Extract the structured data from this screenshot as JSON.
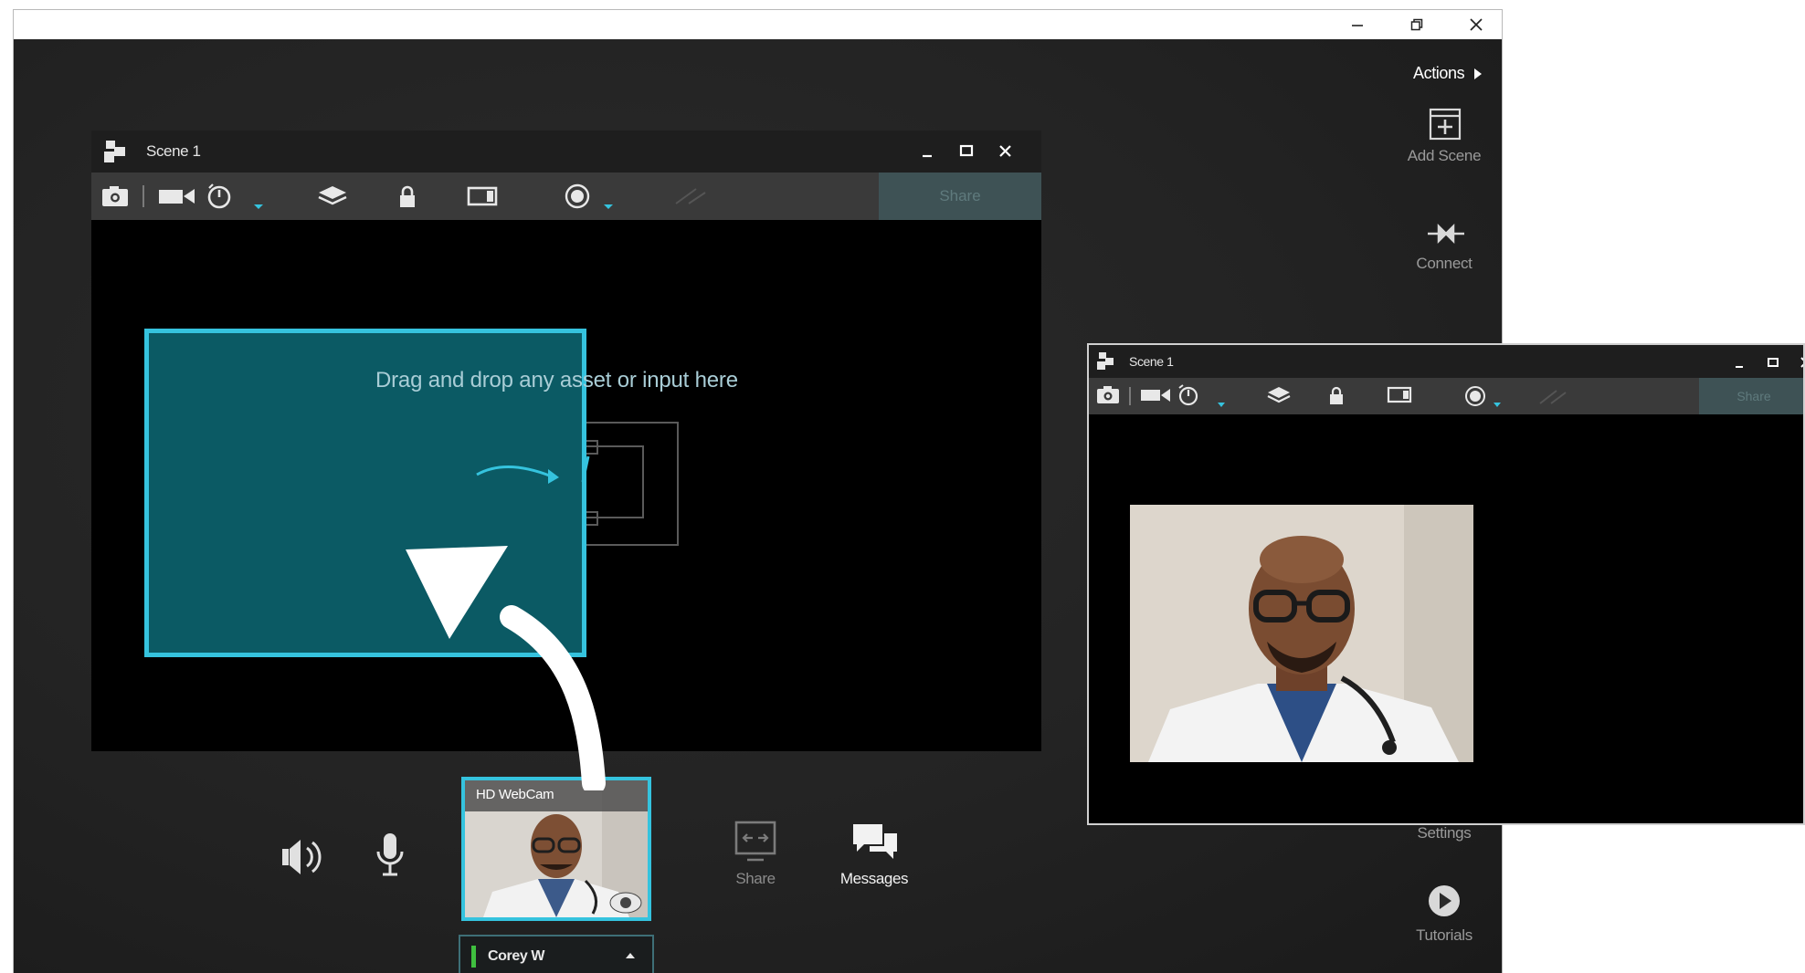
{
  "window_controls": {
    "minimize": "–",
    "restore": "⧉",
    "close": "✕"
  },
  "actions": {
    "label": "Actions"
  },
  "right_rail": {
    "add_scene": "Add Scene",
    "connect": "Connect",
    "settings": "Settings",
    "tutorials": "Tutorials"
  },
  "scene_main": {
    "title": "Scene 1",
    "share": "Share",
    "drop_hint": "Drag and drop any asset or input here"
  },
  "scene_popout": {
    "title": "Scene 1",
    "share": "Share"
  },
  "bottom_bar": {
    "share": "Share",
    "messages": "Messages",
    "webcam_label": "HD WebCam",
    "user_name": "Corey W"
  },
  "colors": {
    "accent": "#35c3de",
    "drop_fill": "#0b5a64",
    "status_green": "#3fbf3f",
    "app_bg": "#232323"
  },
  "icons": [
    "snapshot-icon",
    "video-camera-icon",
    "timer-icon",
    "layers-icon",
    "lock-icon",
    "fit-screen-icon",
    "record-icon",
    "pen-icon",
    "volume-icon",
    "microphone-icon",
    "screen-share-icon",
    "messages-icon",
    "add-scene-icon",
    "connect-icon",
    "tutorials-icon"
  ]
}
